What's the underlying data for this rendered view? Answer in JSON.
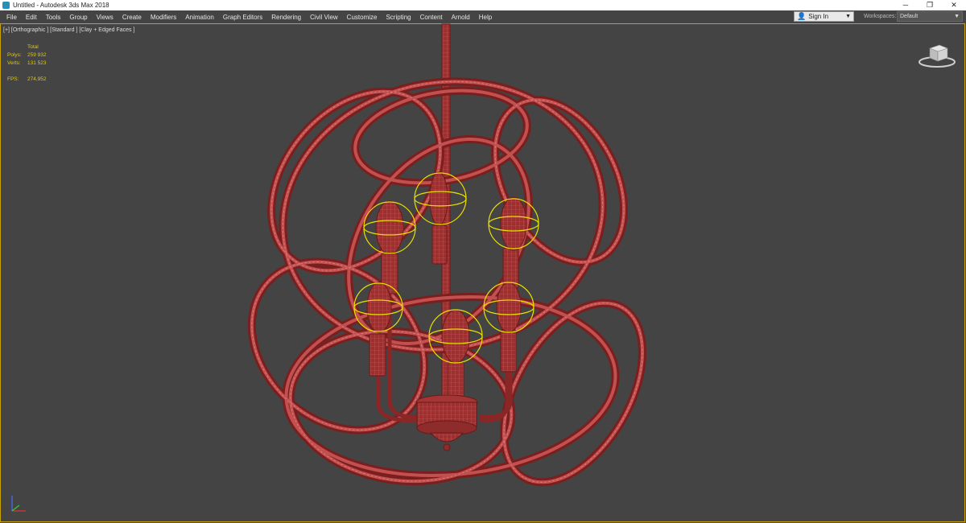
{
  "window": {
    "title": "Untitled - Autodesk 3ds Max 2018",
    "controls": {
      "minimize": "─",
      "restore": "❐",
      "close": "✕"
    }
  },
  "menu": {
    "items": [
      "File",
      "Edit",
      "Tools",
      "Group",
      "Views",
      "Create",
      "Modifiers",
      "Animation",
      "Graph Editors",
      "Rendering",
      "Civil View",
      "Customize",
      "Scripting",
      "Content",
      "Arnold",
      "Help"
    ]
  },
  "signin": {
    "label": "Sign In",
    "icon": "user-icon"
  },
  "workspaces": {
    "label": "Workspaces:",
    "value": "Default"
  },
  "viewport": {
    "label": "[+] [Orthographic ] [Standard ] [Clay + Edged Faces ]",
    "stats": {
      "header": "Total",
      "polys_label": "Polys:",
      "polys": "259 932",
      "verts_label": "Verts:",
      "verts": "131 523",
      "fps_label": "FPS:",
      "fps": "274,952"
    }
  },
  "colors": {
    "model": "#b23a3a",
    "selection": "#e8e000",
    "viewport_border": "#c8a200",
    "background": "#444444"
  }
}
